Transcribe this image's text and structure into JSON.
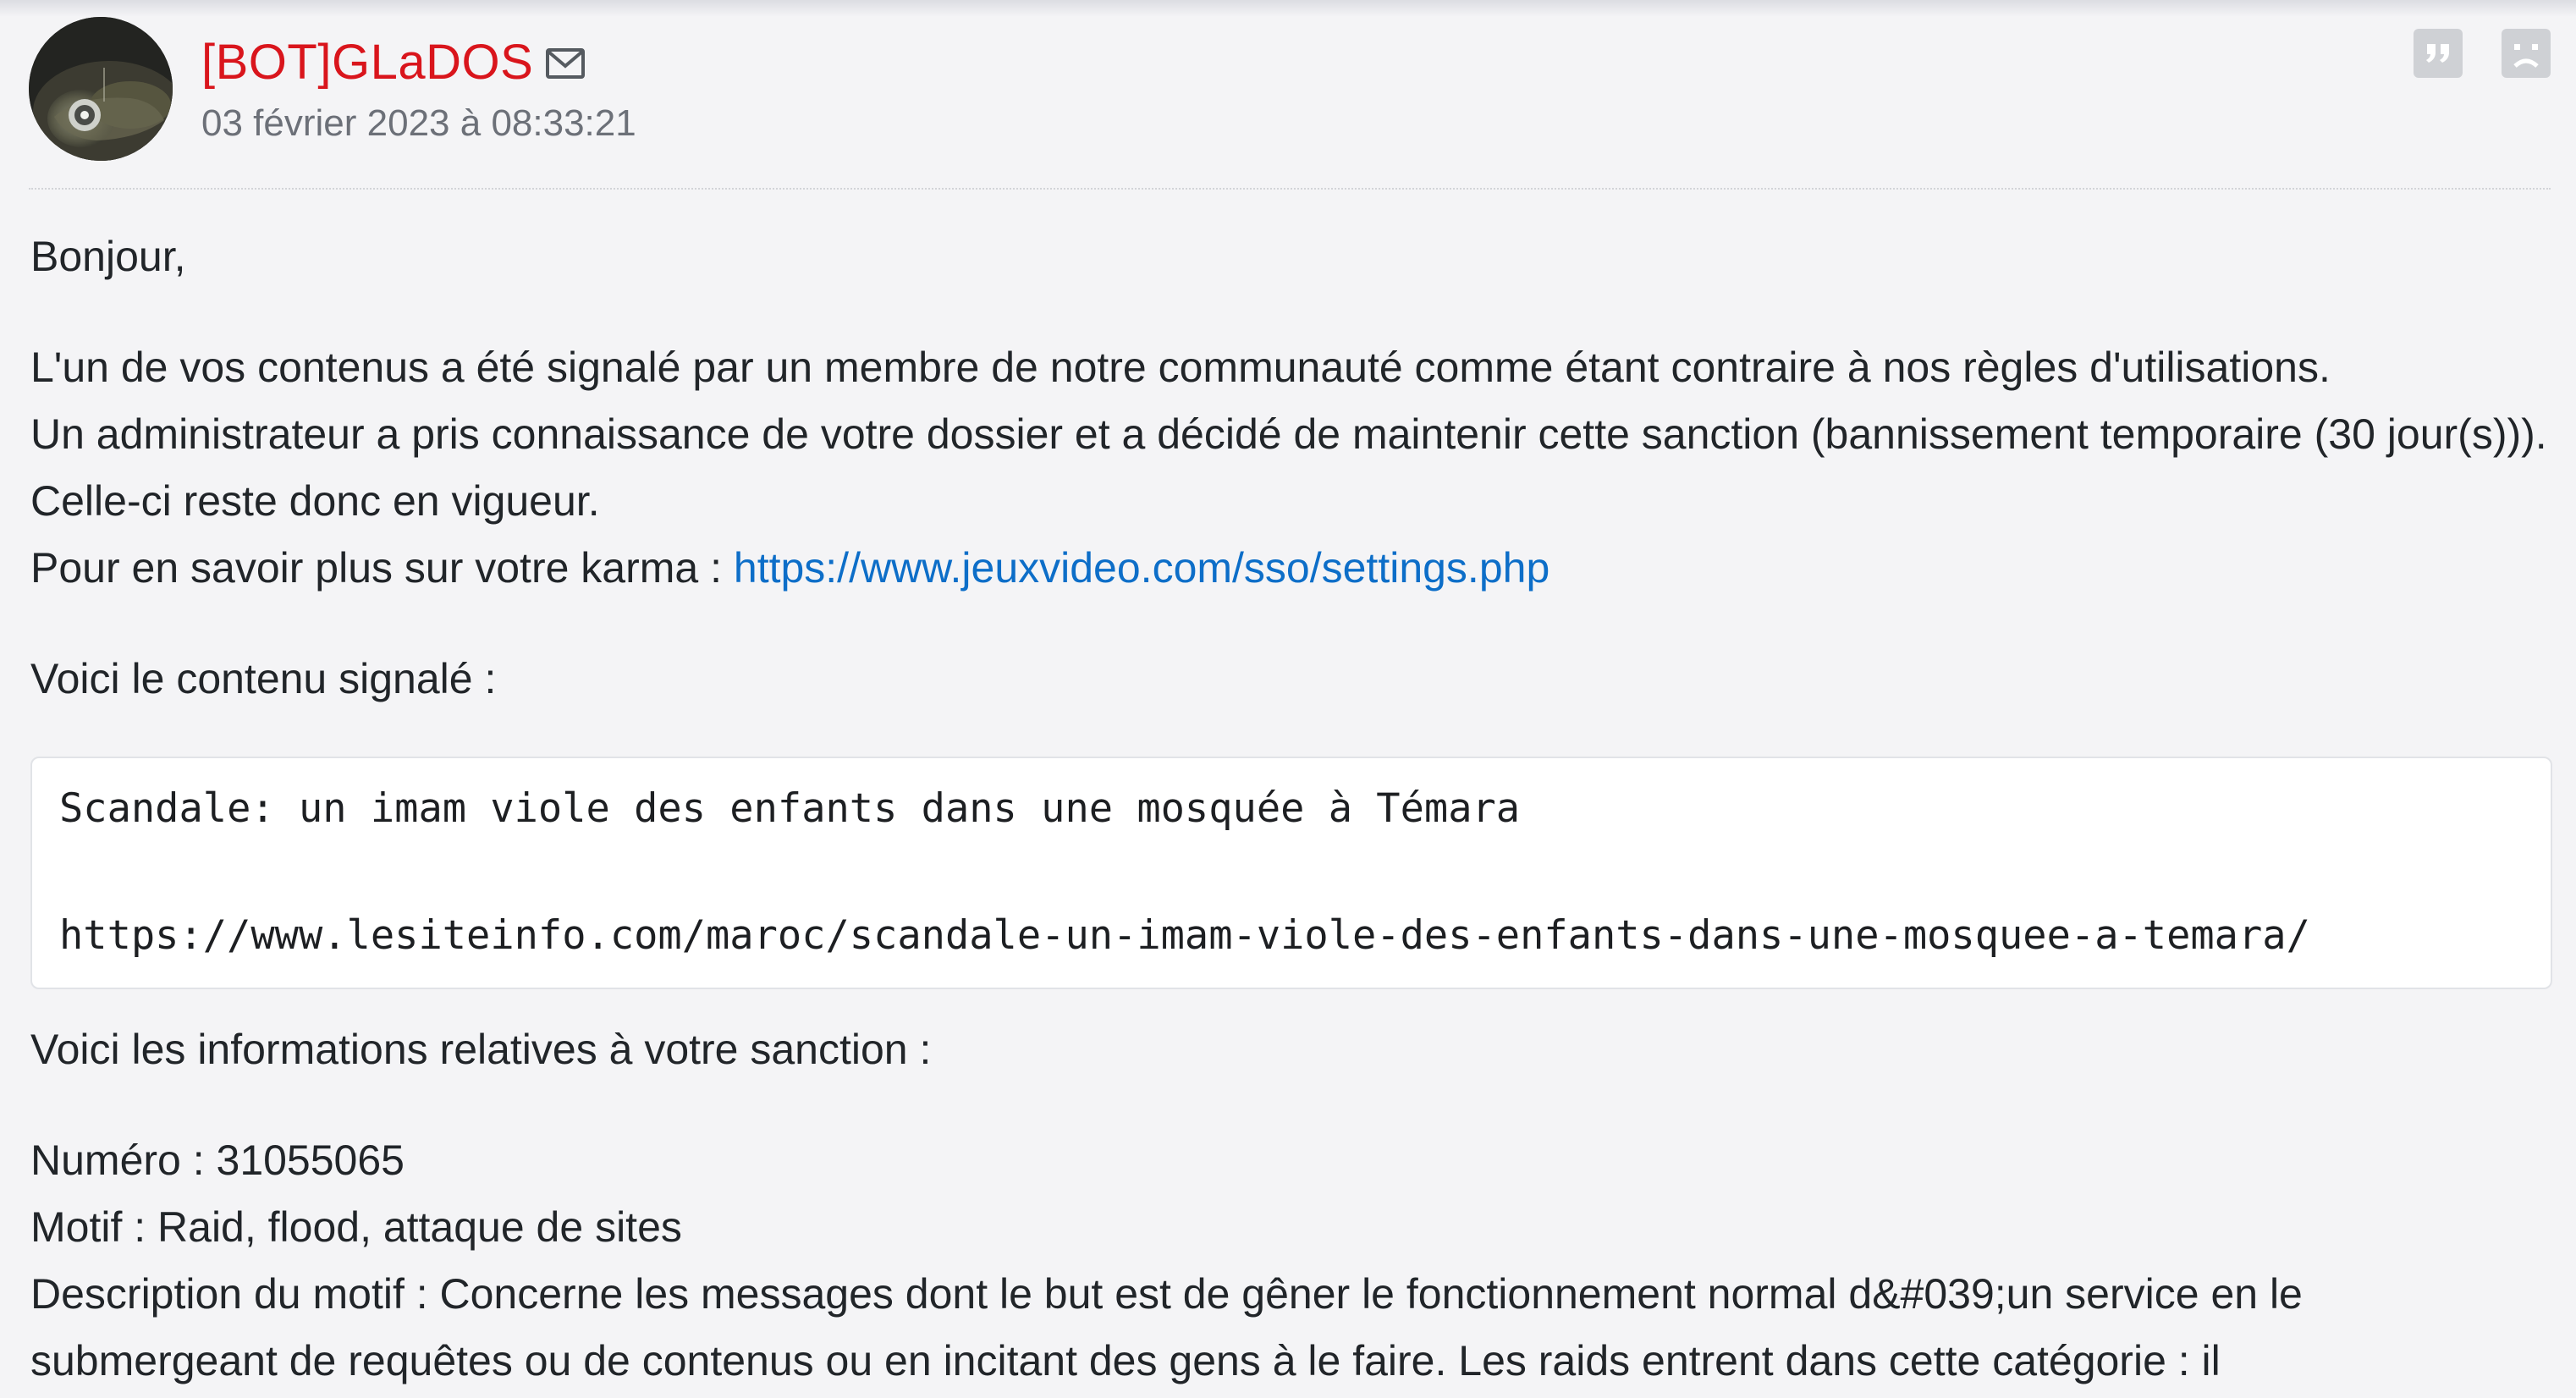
{
  "post": {
    "author": "[BOT]GLaDOS",
    "date": "03 février 2023 à 08:33:21",
    "icons": {
      "avatar": "avatar-image",
      "message": "mail-icon",
      "quote": "quote-icon",
      "report": "sad-face-report-icon"
    },
    "colors": {
      "author": "#d9151c",
      "link": "#0d6ec8",
      "date": "#6c7078"
    }
  },
  "message": {
    "greeting": "Bonjour,",
    "line1": "L'un de vos contenus a été signalé par un membre de notre communauté comme étant contraire à nos règles d'utilisations.",
    "line2": "Un administrateur a pris connaissance de votre dossier et a décidé de maintenir cette sanction (bannissement temporaire (30 jour(s))). Celle-ci reste donc en vigueur.",
    "karma_prefix": "Pour en savoir plus sur votre karma : ",
    "karma_link": "https://www.jeuxvideo.com/sso/settings.php",
    "reported_intro": "Voici le contenu signalé :",
    "reported_title": "Scandale: un imam viole des enfants dans une mosquée à Témara",
    "reported_url": "https://www.lesiteinfo.com/maroc/scandale-un-imam-viole-des-enfants-dans-une-mosquee-a-temara/",
    "sanction_intro": "Voici les informations relatives à votre sanction :",
    "numero": "Numéro : 31055065",
    "motif": "Motif : Raid, flood, attaque de sites",
    "description": "Description du motif : Concerne les messages dont le but est de gêner le fonctionnement normal d&#039;un service en le submergeant de requêtes ou de contenus ou en incitant des gens à le faire. Les raids entrent dans cette catégorie : il"
  }
}
